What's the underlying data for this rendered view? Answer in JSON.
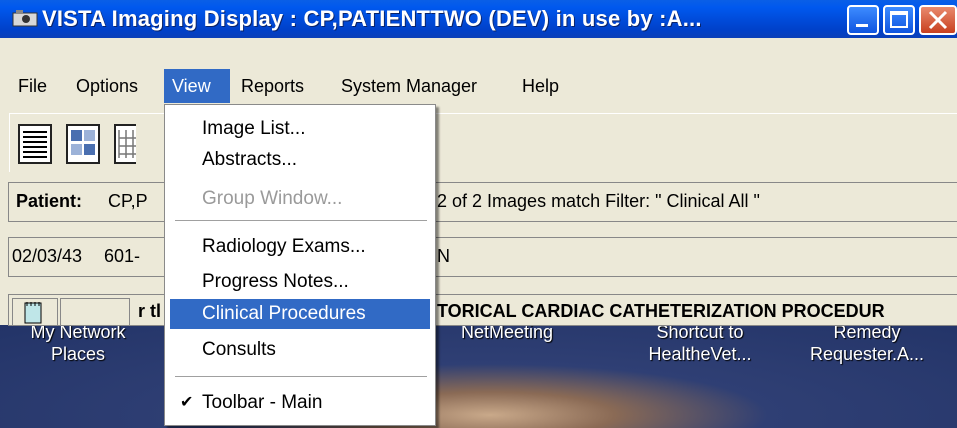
{
  "window": {
    "title": "VISTA Imaging Display : CP,PATIENTTWO (DEV) in use by :A..."
  },
  "menubar": {
    "items": [
      "File",
      "Options",
      "View",
      "Reports",
      "System Manager",
      "Help"
    ],
    "active": "View"
  },
  "view_menu": {
    "items": [
      {
        "label": "Image List...",
        "enabled": true
      },
      {
        "label": "Abstracts...",
        "enabled": true
      },
      {
        "label": "Group Window...",
        "enabled": false
      },
      {
        "label": "Radiology Exams...",
        "enabled": true
      },
      {
        "label": "Progress Notes...",
        "enabled": true
      },
      {
        "label": "Clinical Procedures",
        "enabled": true,
        "highlighted": true
      },
      {
        "label": "Consults",
        "enabled": true
      },
      {
        "label": "Toolbar - Main",
        "enabled": true,
        "checked": true
      }
    ]
  },
  "patient_bar": {
    "label": "Patient:",
    "value_partial": "CP,P",
    "filter_text": "2 of 2 Images match Filter: \" Clinical All \""
  },
  "info_bar": {
    "dob": "02/03/43",
    "id_partial": "601-",
    "suffix": "N"
  },
  "status_bar": {
    "left_partial": "r tl",
    "right_text": "TORICAL CARDIAC CATHETERIZATION PROCEDUR"
  },
  "desktop_icons": [
    {
      "line1": "My Network",
      "line2": "Places"
    },
    {
      "line1": "NetMeeting",
      "line2": ""
    },
    {
      "line1": "Shortcut to",
      "line2": "HealtheVet..."
    },
    {
      "line1": "Remedy",
      "line2": "Requester.A..."
    }
  ],
  "colors": {
    "titlebar": "#0058ee",
    "selection": "#316ac5",
    "window_bg": "#ece9d8"
  }
}
